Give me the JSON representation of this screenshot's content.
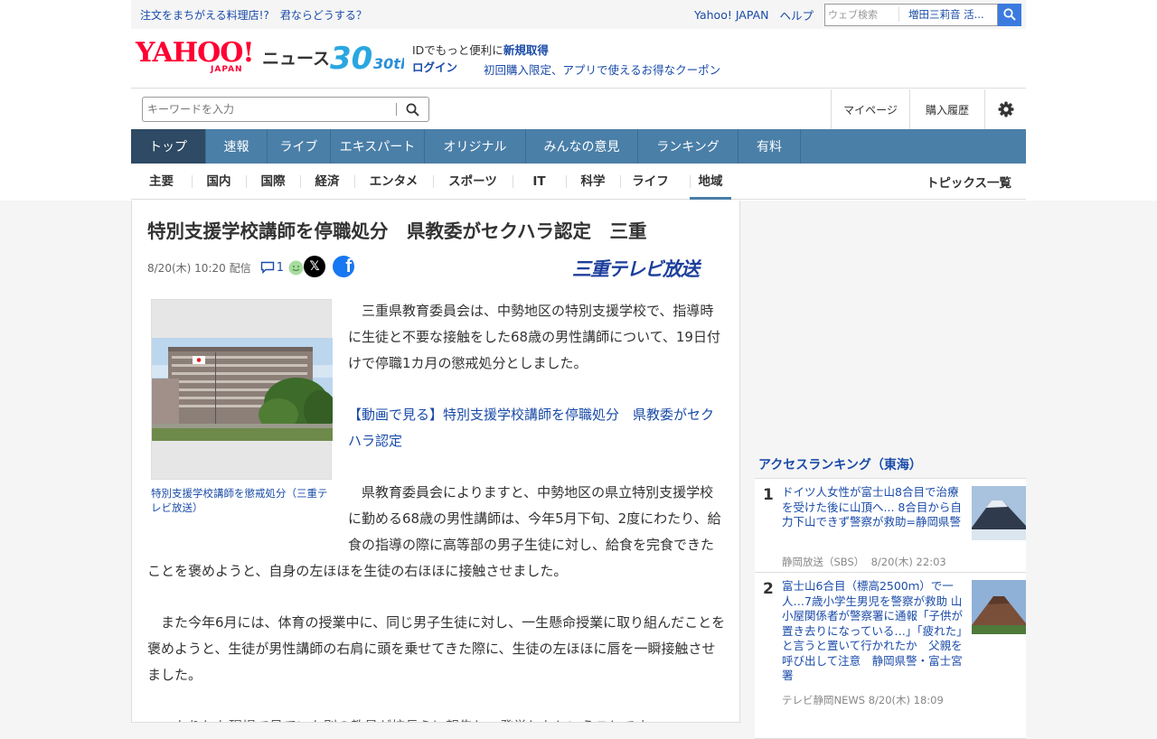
{
  "header": {
    "promo_link": "注文をまちがえる料理店!?　君ならどうする？",
    "yahoo_japan": "Yahoo! JAPAN",
    "help": "ヘルプ",
    "web_search_placeholder": "ウェブ検索",
    "web_search_suggest": "増田三莉音 活...",
    "logo_text": "YAHOO!",
    "logo_sub": "JAPAN",
    "news_label": "ニュース",
    "anniversary": "30th",
    "id_promo": "IDでもっと便利に",
    "id_new": "新規取得",
    "login": "ログイン",
    "coupon": "初回購入限定、アプリで使えるお得なクーポン",
    "keyword_placeholder": "キーワードを入力",
    "mypage": "マイページ",
    "history": "購入履歴"
  },
  "global_nav": [
    "トップ",
    "速報",
    "ライブ",
    "エキスパート",
    "オリジナル",
    "みんなの意見",
    "ランキング",
    "有料"
  ],
  "category_nav": [
    "主要",
    "国内",
    "国際",
    "経済",
    "エンタメ",
    "スポーツ",
    "IT",
    "科学",
    "ライフ",
    "地域"
  ],
  "topics_list": "トピックス一覧",
  "article": {
    "title": "特別支援学校講師を停職処分　県教委がセクハラ認定　三重",
    "date": "8/20(木) 10:20",
    "delivered": "配信",
    "comments": "1",
    "source": "三重テレビ放送",
    "caption": "特別支援学校講師を懲戒処分（三重テレビ放送）",
    "paragraphs": [
      "三重県教育委員会は、中勢地区の特別支援学校で、指導時に生徒と不要な接触をした68歳の男性講師について、19日付けで停職1カ月の懲戒処分としました。",
      "【動画で見る】特別支援学校講師を停職処分　県教委がセクハラ認定",
      "県教育委員会によりますと、中勢地区の県立特別支援学校に勤める68歳の男性講師は、今年5月下旬、2度にわたり、給食の指導の際に高等部の男子生徒に対し、給食を完食できたことを褒めようと、自身の左ほほを生徒の右ほほに接触させました。",
      "また今年6月には、体育の授業中に、同じ男子生徒に対し、一生懸命授業に取り組んだことを褒めようと、生徒が男性講師の右肩に頭を乗せてきた際に、生徒の左ほほに唇を一瞬接触させました。",
      "…たりした現場で見ていた別の教員が校長らに報告し、発覚したということです。"
    ]
  },
  "ranking": {
    "title": "アクセスランキング（東海）",
    "items": [
      {
        "rank": "1",
        "title": "ドイツ人女性が富士山8合目で治療を受けた後に山頂へ... 8合目から自力下山できず警察が救助=静岡県警",
        "source": "静岡放送（SBS）",
        "time": "8/20(木) 22:03"
      },
      {
        "rank": "2",
        "title": "富士山6合目（標高2500ｍ）で一人…7歳小学生男児を警察が救助 山小屋関係者が警察署に通報「子供が置き去りになっている…」「疲れた」と言うと置いて行かれたか　父親を呼び出して注意　静岡県警・富士宮署",
        "source": "テレビ静岡NEWS",
        "time": "8/20(木) 18:09"
      }
    ]
  },
  "colors": {
    "accent_blue": "#4a7fa8",
    "nav_active": "#2e4a64",
    "link": "#1a4ba8",
    "logo_red": "#ff0033",
    "search_button": "#3b7be0"
  }
}
